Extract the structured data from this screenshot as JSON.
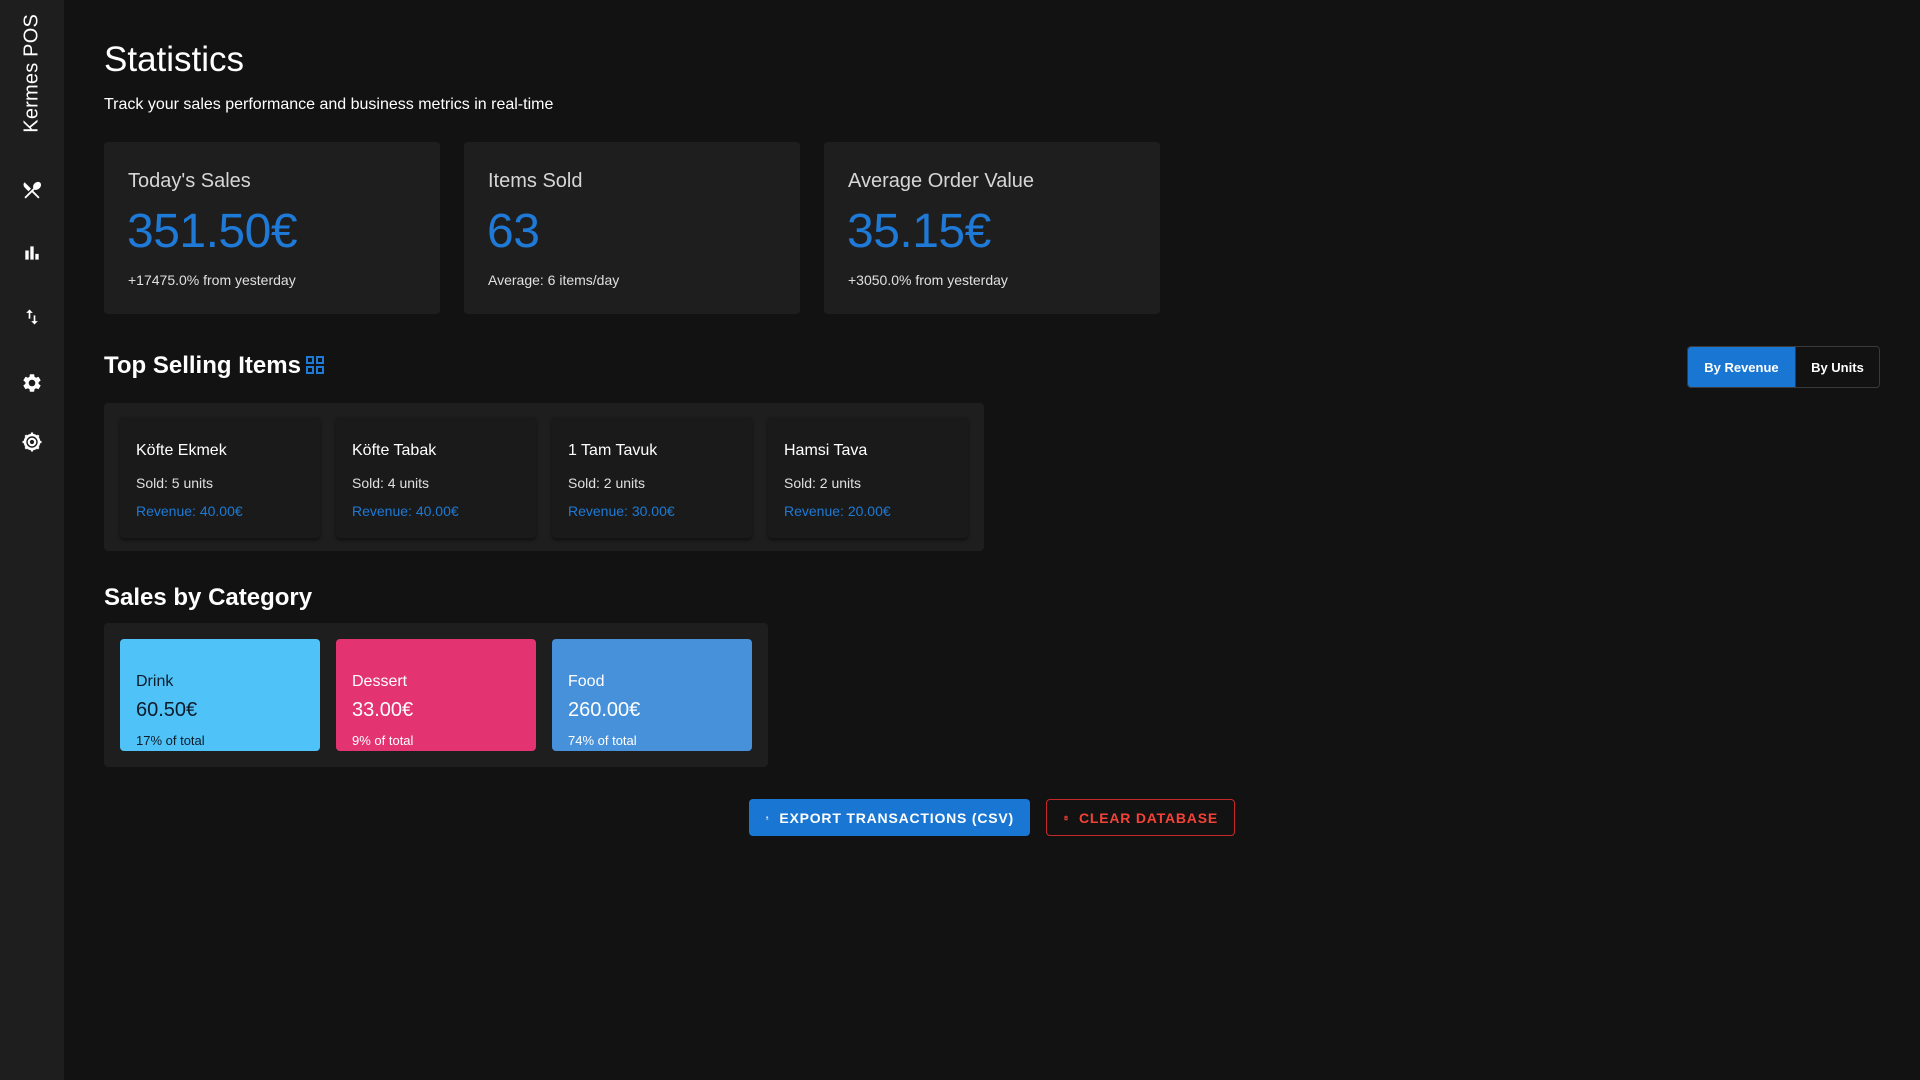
{
  "app": {
    "name": "Kermes POS"
  },
  "sidebar": {
    "items": [
      {
        "icon": "utensils-icon"
      },
      {
        "icon": "bar-chart-icon"
      },
      {
        "icon": "transfer-arrows-icon"
      },
      {
        "icon": "gear-icon"
      },
      {
        "icon": "cog-settings-icon"
      }
    ]
  },
  "header": {
    "title": "Statistics",
    "subtitle": "Track your sales performance and business metrics in real-time"
  },
  "stats": [
    {
      "label": "Today's Sales",
      "value": "351.50€",
      "note": "+17475.0% from yesterday"
    },
    {
      "label": "Items Sold",
      "value": "63",
      "note": "Average: 6 items/day"
    },
    {
      "label": "Average Order Value",
      "value": "35.15€",
      "note": "+3050.0% from yesterday"
    }
  ],
  "top_selling": {
    "title": "Top Selling Items",
    "toggle": {
      "by_revenue": "By Revenue",
      "by_units": "By Units",
      "active": "by_revenue"
    },
    "items": [
      {
        "name": "Köfte Ekmek",
        "sold": "Sold: 5 units",
        "revenue": "Revenue: 40.00€"
      },
      {
        "name": "Köfte Tabak",
        "sold": "Sold: 4 units",
        "revenue": "Revenue: 40.00€"
      },
      {
        "name": "1 Tam Tavuk",
        "sold": "Sold: 2 units",
        "revenue": "Revenue: 30.00€"
      },
      {
        "name": "Hamsi Tava",
        "sold": "Sold: 2 units",
        "revenue": "Revenue: 20.00€"
      }
    ]
  },
  "categories": {
    "title": "Sales by Category",
    "items": [
      {
        "name": "Drink",
        "value": "60.50€",
        "pct": "17% of total",
        "color": "#4fc3f7",
        "text_color": "#0d1b2a"
      },
      {
        "name": "Dessert",
        "value": "33.00€",
        "pct": "9% of total",
        "color": "#e33371",
        "text_color": "#ffffff"
      },
      {
        "name": "Food",
        "value": "260.00€",
        "pct": "74% of total",
        "color": "#4791db",
        "text_color": "#ffffff"
      }
    ]
  },
  "actions": {
    "export_label": "EXPORT TRANSACTIONS (CSV)",
    "clear_label": "CLEAR DATABASE"
  },
  "colors": {
    "accent": "#1976d2",
    "value_blue": "#1e7ad6",
    "danger": "#f44336"
  }
}
